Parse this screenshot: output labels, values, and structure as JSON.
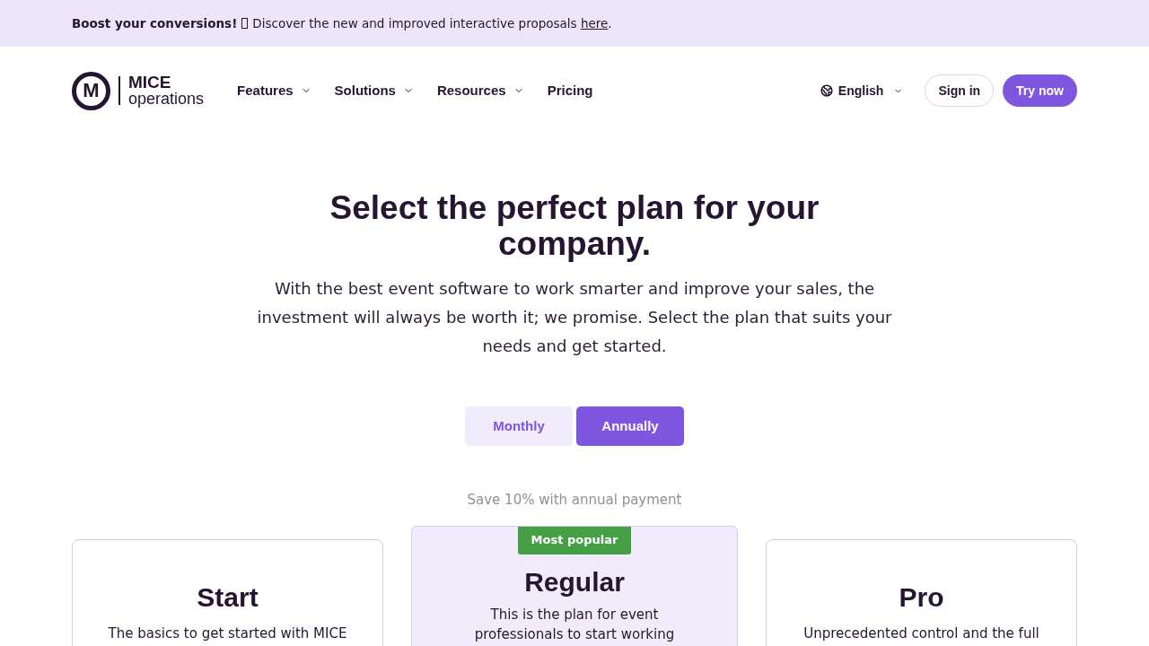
{
  "banner": {
    "lead": "Boost your conversions!",
    "text": "Discover the new and improved interactive proposals",
    "link": "here",
    "end": "."
  },
  "header": {
    "logo": {
      "mark": "M",
      "name": "MICE",
      "tagline": "operations"
    },
    "nav": [
      {
        "label": "Features",
        "has_menu": true
      },
      {
        "label": "Solutions",
        "has_menu": true
      },
      {
        "label": "Resources",
        "has_menu": true
      },
      {
        "label": "Pricing",
        "has_menu": false
      }
    ],
    "language": {
      "label": "English"
    },
    "sign_in": "Sign in",
    "try_now": "Try now"
  },
  "hero": {
    "title": "Select the perfect plan for your company.",
    "subtitle": "With the best event software to work smarter and improve your sales, the investment will always be worth it; we promise. Select the plan that suits your needs and get started."
  },
  "billing": {
    "options": [
      {
        "label": "Monthly",
        "selected": false
      },
      {
        "label": "Annually",
        "selected": true
      }
    ],
    "note": "Save 10% with annual payment"
  },
  "plans": [
    {
      "name": "Start",
      "description": "The basics to get started with MICE",
      "featured": false
    },
    {
      "name": "Regular",
      "badge": "Most popular",
      "description": "This is the plan for event professionals to start working",
      "featured": true
    },
    {
      "name": "Pro",
      "description": "Unprecedented control and the full",
      "featured": false
    }
  ]
}
